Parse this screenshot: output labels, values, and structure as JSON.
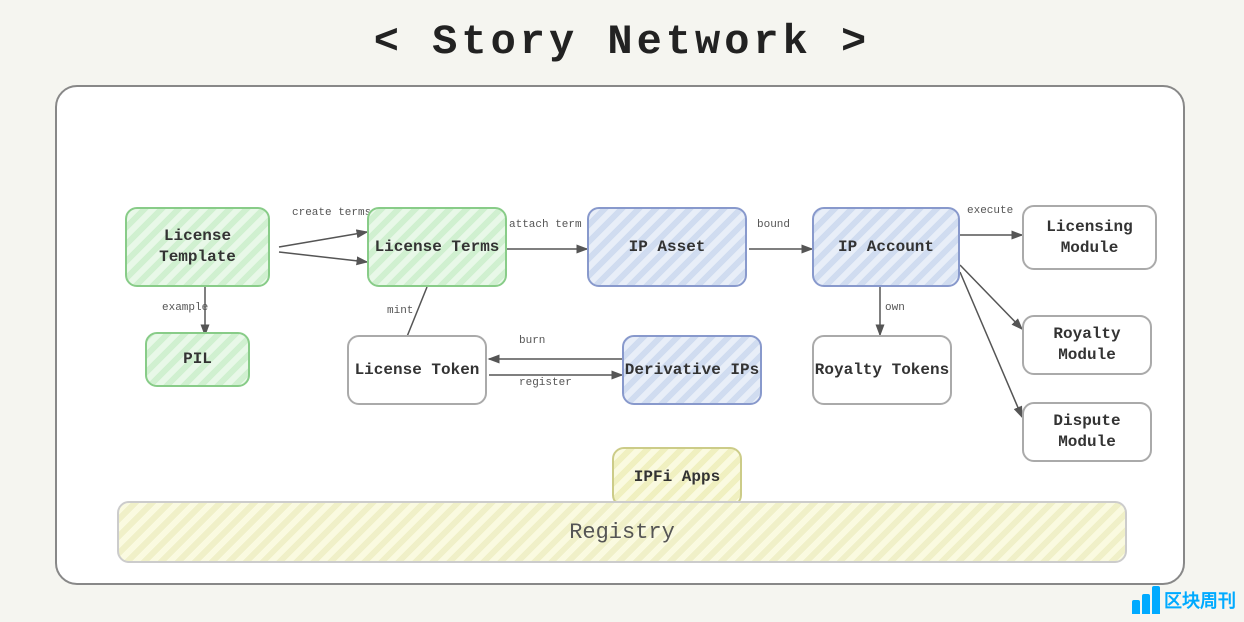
{
  "title": "< Story Network >",
  "nodes": {
    "license_template": {
      "label": "License\nTemplate"
    },
    "license_terms": {
      "label": "License\nTerms"
    },
    "ip_asset": {
      "label": "IP\nAsset"
    },
    "ip_account": {
      "label": "IP\nAccount"
    },
    "licensing_module": {
      "label": "Licensing\nModule"
    },
    "pil": {
      "label": "PIL"
    },
    "license_token": {
      "label": "License\nToken"
    },
    "derivative_ips": {
      "label": "Derivative\nIPs"
    },
    "royalty_tokens": {
      "label": "Royalty\nTokens"
    },
    "royalty_module": {
      "label": "Royalty\nModule"
    },
    "dispute_module": {
      "label": "Dispute\nModule"
    },
    "ipfi_apps": {
      "label": "IPFi\nApps"
    }
  },
  "arrow_labels": {
    "create_terms": "create\nterms",
    "attach_term": "attach\nterm",
    "bound": "bound",
    "execute": "execute",
    "example": "example",
    "mint": "mint",
    "burn": "burn",
    "register": "register",
    "own": "own"
  },
  "registry_label": "Registry",
  "watermark": {
    "text": "区块周刊",
    "bars": [
      14,
      20,
      28
    ]
  }
}
